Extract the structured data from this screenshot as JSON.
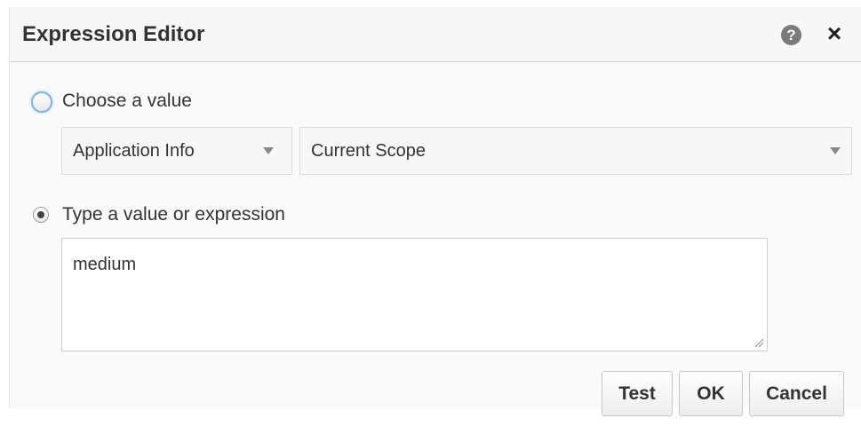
{
  "dialog": {
    "title": "Expression Editor",
    "help_icon": "?",
    "close_icon": "×"
  },
  "choose": {
    "label": "Choose a value",
    "selected": false,
    "category_select": {
      "value": "Application Info"
    },
    "scope_select": {
      "value": "Current Scope"
    }
  },
  "expression": {
    "label": "Type a value or expression",
    "selected": true,
    "value": "medium"
  },
  "buttons": {
    "test": "Test",
    "ok": "OK",
    "cancel": "Cancel"
  },
  "colors": {
    "title_bar_bg": "#f7f7f7",
    "title_bar_border": "#c9d3dc",
    "focus_ring": "#7fb2e5",
    "text": "#333333"
  },
  "icons": [
    "help-icon",
    "close-icon",
    "chevron-down-icon",
    "resize-grip-icon"
  ]
}
